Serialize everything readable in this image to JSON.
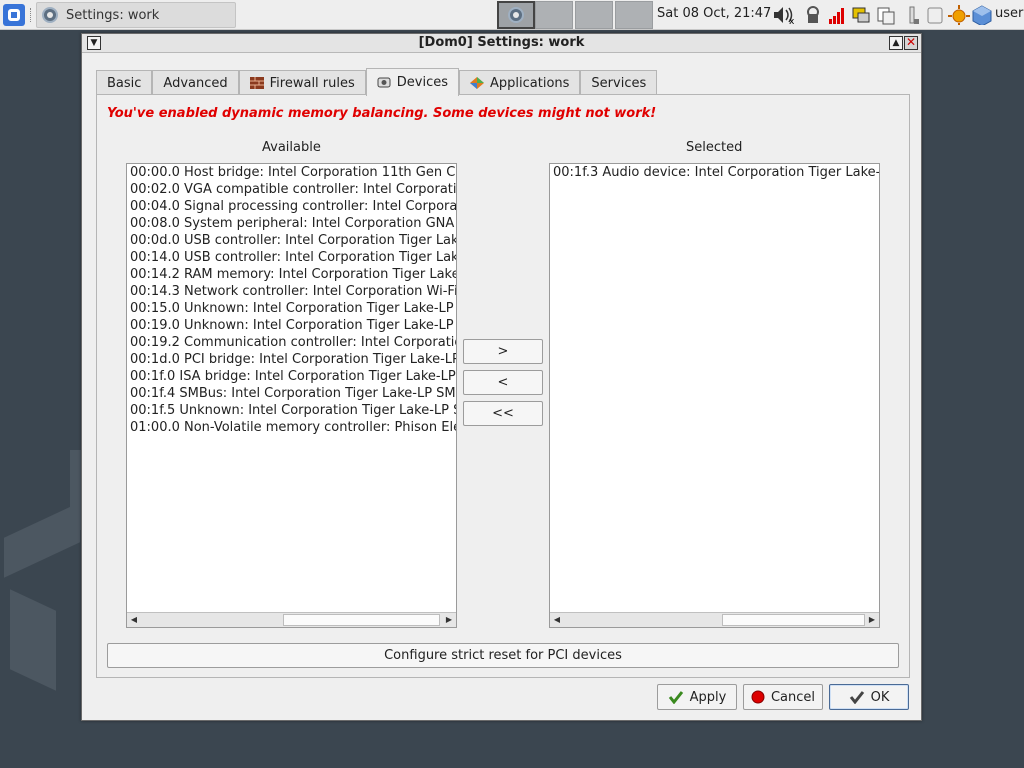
{
  "taskbar": {
    "task_title": "Settings: work",
    "clock": "Sat 08 Oct, 21:47",
    "user": "user"
  },
  "window": {
    "title": "[Dom0] Settings: work"
  },
  "tabs": [
    {
      "label": "Basic",
      "icon": ""
    },
    {
      "label": "Advanced",
      "icon": ""
    },
    {
      "label": "Firewall rules",
      "icon": "firewall-icon"
    },
    {
      "label": "Devices",
      "icon": "devices-icon",
      "active": true
    },
    {
      "label": "Applications",
      "icon": "applications-icon"
    },
    {
      "label": "Services",
      "icon": ""
    }
  ],
  "devices": {
    "warning": "You've enabled dynamic memory balancing. Some devices might not work!",
    "available_label": "Available",
    "selected_label": "Selected",
    "available": [
      "00:00.0 Host bridge: Intel Corporation 11th Gen C",
      "00:02.0 VGA compatible controller: Intel Corporati",
      "00:04.0 Signal processing controller: Intel Corpora",
      "00:08.0 System peripheral: Intel Corporation GNA",
      "00:0d.0 USB controller: Intel Corporation Tiger Lak",
      "00:14.0 USB controller: Intel Corporation Tiger Lak",
      "00:14.2 RAM memory: Intel Corporation Tiger Lake",
      "00:14.3 Network controller: Intel Corporation Wi-Fi",
      "00:15.0 Unknown: Intel Corporation Tiger Lake-LP",
      "00:19.0 Unknown: Intel Corporation Tiger Lake-LP",
      "00:19.2 Communication controller: Intel Corporatio",
      "00:1d.0 PCI bridge: Intel Corporation Tiger Lake-LP",
      "00:1f.0 ISA bridge: Intel Corporation Tiger Lake-LP",
      "00:1f.4 SMBus: Intel Corporation Tiger Lake-LP SM",
      "00:1f.5 Unknown: Intel Corporation Tiger Lake-LP S",
      "01:00.0 Non-Volatile memory controller: Phison Ele"
    ],
    "selected": [
      "00:1f.3 Audio device: Intel Corporation Tiger Lake-"
    ],
    "add_label": ">",
    "remove_label": "<",
    "remove_all_label": "<<",
    "strict_reset_label": "Configure strict reset for PCI devices"
  },
  "buttons": {
    "apply": "Apply",
    "cancel": "Cancel",
    "ok": "OK"
  },
  "colors": {
    "warning": "#e00000",
    "desktop": "#3b4650",
    "qubes_blue": "#3874d8"
  }
}
